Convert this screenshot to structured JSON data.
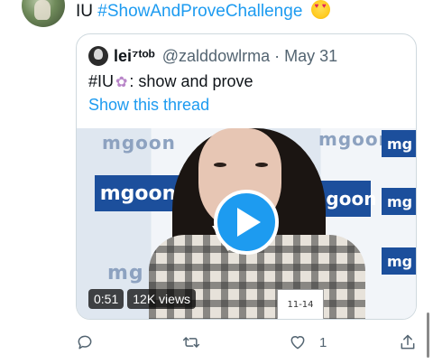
{
  "tweet": {
    "author_name": "IU",
    "hashtag": "#ShowAndProveChallenge",
    "emoji_icon": "heart-eyes-emoji"
  },
  "quote": {
    "name": "lei⁷ᵗᵒᵇ",
    "handle": "@zalddowlrma",
    "separator": "·",
    "date": "May 31",
    "text_prefix": "#IU",
    "text_suffix": ": show and prove",
    "flower_icon": "flower-emoji",
    "show_thread": "Show this thread"
  },
  "video": {
    "duration": "0:51",
    "views": "12K views",
    "backdrop_brand": "mgoon",
    "backdrop_brand_short": "mg",
    "nametag": "11-14",
    "play_icon": "play-icon",
    "accent": "#1d9bf0"
  },
  "actions": {
    "reply_icon": "reply-icon",
    "retweet_icon": "retweet-icon",
    "like_icon": "heart-icon",
    "like_count": "1",
    "share_icon": "share-icon"
  }
}
